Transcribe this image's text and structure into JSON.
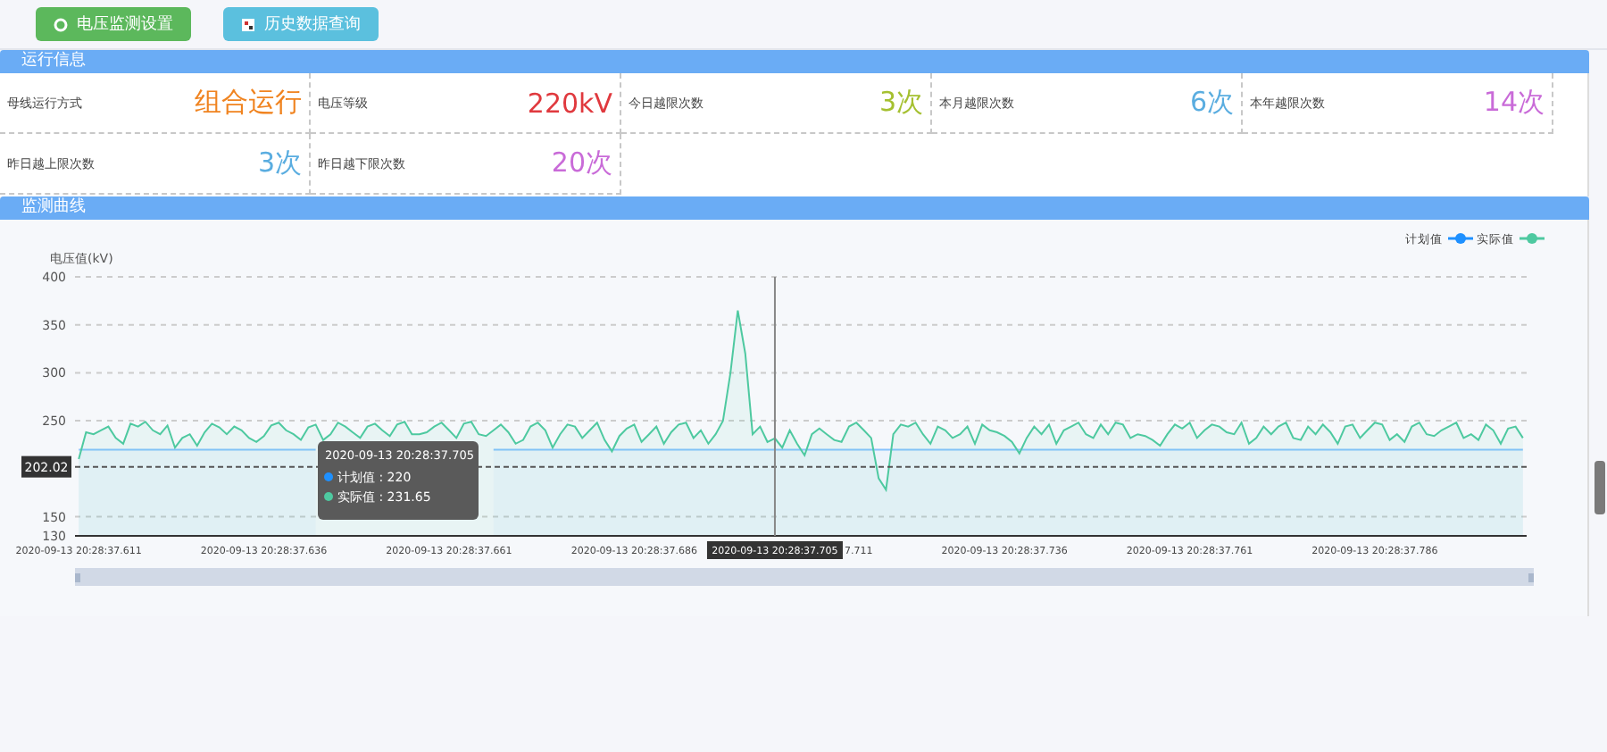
{
  "toolbar": {
    "buttons": [
      {
        "label": "电压监测设置",
        "kind": "settings",
        "color": "#5cb85c"
      },
      {
        "label": "历史数据查询",
        "kind": "query",
        "color": "#5bc0de"
      }
    ]
  },
  "run_info": {
    "title": "运行信息",
    "rows": [
      [
        {
          "label": "母线运行方式",
          "value": "组合运行",
          "color": "#f0831f"
        },
        {
          "label": "电压等级",
          "value": "220kV",
          "color": "#e0393e"
        },
        {
          "label": "今日越限次数",
          "value": "3次",
          "color": "#a5c030"
        },
        {
          "label": "本月越限次数",
          "value": "6次",
          "color": "#5aade0"
        },
        {
          "label": "本年越限次数",
          "value": "14次",
          "color": "#c96bd8"
        }
      ],
      [
        {
          "label": "昨日越上限次数",
          "value": "3次",
          "color": "#5aade0"
        },
        {
          "label": "昨日越下限次数",
          "value": "20次",
          "color": "#c96bd8"
        }
      ]
    ]
  },
  "curve": {
    "title": "监测曲线",
    "pointer": {
      "x_label": "2020-09-13 20:28:37.705",
      "partly_hidden_tick": "7.711"
    },
    "tooltip": {
      "time": "2020-09-13 20:28:37.705",
      "lines": [
        {
          "label": "计划值 : 220",
          "color": "#1e90ff"
        },
        {
          "label": "实际值 : 231.65",
          "color": "#4ec9a0"
        }
      ]
    },
    "chart_data": {
      "type": "area",
      "ylabel": "电压值(kV)",
      "ylim": [
        130,
        400
      ],
      "yticks": [
        130,
        150,
        250,
        300,
        350,
        400
      ],
      "grid": true,
      "legend": "top-right",
      "ref_lines": [
        {
          "axis": "y",
          "value": 202.02,
          "label": "202.02"
        }
      ],
      "categories": [
        "2020-09-13 20:28:37.611",
        null,
        null,
        null,
        null,
        null,
        null,
        null,
        null,
        null,
        null,
        null,
        null,
        null,
        null,
        null,
        null,
        null,
        null,
        null,
        null,
        null,
        null,
        null,
        null,
        "2020-09-13 20:28:37.636",
        null,
        null,
        null,
        null,
        null,
        null,
        null,
        null,
        null,
        null,
        null,
        null,
        null,
        null,
        null,
        null,
        null,
        null,
        null,
        null,
        null,
        null,
        null,
        null,
        "2020-09-13 20:28:37.661",
        null,
        null,
        null,
        null,
        null,
        null,
        null,
        null,
        null,
        null,
        null,
        null,
        null,
        null,
        null,
        null,
        null,
        null,
        null,
        null,
        null,
        null,
        null,
        null,
        "2020-09-13 20:28:37.686",
        null,
        null,
        null,
        null,
        null,
        null,
        null,
        null,
        null,
        null,
        null,
        null,
        null,
        null,
        null,
        null,
        null,
        null,
        null,
        null,
        null,
        null,
        null,
        null,
        null,
        null,
        null,
        null,
        null,
        null,
        null,
        null,
        null,
        null,
        null,
        null,
        null,
        null,
        null,
        null,
        null,
        null,
        null,
        null,
        null,
        null,
        null,
        null,
        null,
        "2020-09-13 20:28:37.736",
        null,
        null,
        null,
        null,
        null,
        null,
        null,
        null,
        null,
        null,
        null,
        null,
        null,
        null,
        null,
        null,
        null,
        null,
        null,
        null,
        null,
        null,
        null,
        null,
        "2020-09-13 20:28:37.761",
        null,
        null,
        null,
        null,
        null,
        null,
        null,
        null,
        null,
        null,
        null,
        null,
        null,
        null,
        null,
        null,
        null,
        null,
        null,
        null,
        null,
        null,
        null,
        null,
        "2020-09-13 20:28:37.786",
        null,
        null,
        null,
        null,
        null,
        null,
        null,
        null,
        null,
        null,
        null,
        null,
        null,
        null,
        null,
        null,
        null,
        null,
        null,
        null
      ],
      "series": [
        {
          "name": "计划值",
          "color": "#1e90ff",
          "values": [
            220,
            220,
            220,
            220,
            220,
            220,
            220,
            220,
            220,
            220,
            220,
            220,
            220,
            220,
            220,
            220,
            220,
            220,
            220,
            220,
            220,
            220,
            220,
            220,
            220,
            220,
            220,
            220,
            220,
            220,
            220,
            220,
            220,
            null,
            null,
            null,
            null,
            null,
            null,
            null,
            null,
            null,
            null,
            null,
            null,
            null,
            null,
            null,
            null,
            null,
            null,
            null,
            null,
            null,
            null,
            null,
            220,
            220,
            220,
            220,
            220,
            220,
            220,
            220,
            220,
            220,
            220,
            220,
            220,
            220,
            220,
            220,
            220,
            220,
            220,
            220,
            220,
            220,
            220,
            220,
            220,
            220,
            220,
            220,
            220,
            220,
            220,
            220,
            220,
            220,
            220,
            220,
            220,
            220,
            220,
            220,
            220,
            220,
            220,
            220,
            220,
            220,
            220,
            220,
            220,
            220,
            220,
            220,
            220,
            220,
            220,
            220,
            220,
            220,
            220,
            220,
            220,
            220,
            220,
            220,
            220,
            220,
            220,
            220,
            220,
            220,
            220,
            220,
            220,
            220,
            220,
            220,
            220,
            220,
            220,
            220,
            220,
            220,
            220,
            220,
            220,
            220,
            220,
            220,
            220,
            220,
            220,
            220,
            220,
            220,
            220,
            220,
            220,
            220,
            220,
            220,
            220,
            220,
            220,
            220,
            220,
            220,
            220,
            220,
            220,
            220,
            220,
            220,
            220,
            220,
            220,
            220,
            220,
            220,
            220,
            220,
            220,
            220,
            220,
            220,
            220,
            220,
            220,
            220,
            220,
            220,
            220,
            220,
            220,
            220,
            220,
            220,
            220,
            220,
            220,
            220
          ]
        },
        {
          "name": "实际值",
          "color": "#4ec9a0",
          "values": [
            210,
            238,
            236,
            240,
            244,
            232,
            226,
            247,
            244,
            249,
            240,
            236,
            245,
            222,
            232,
            236,
            224,
            238,
            247,
            243,
            236,
            244,
            240,
            232,
            228,
            234,
            245,
            248,
            240,
            236,
            230,
            243,
            246,
            230,
            236,
            248,
            244,
            238,
            232,
            244,
            247,
            240,
            234,
            246,
            249,
            236,
            236,
            238,
            244,
            248,
            240,
            232,
            247,
            249,
            236,
            234,
            240,
            246,
            238,
            226,
            230,
            244,
            248,
            240,
            222,
            236,
            246,
            244,
            232,
            240,
            248,
            230,
            218,
            234,
            242,
            246,
            228,
            236,
            244,
            226,
            238,
            246,
            248,
            232,
            240,
            226,
            236,
            250,
            300,
            365,
            320,
            236,
            244,
            228,
            231.65,
            222,
            240,
            226,
            214,
            236,
            242,
            236,
            230,
            228,
            244,
            248,
            240,
            232,
            190,
            178,
            236,
            246,
            244,
            248,
            236,
            226,
            244,
            240,
            232,
            236,
            244,
            226,
            246,
            240,
            238,
            234,
            228,
            216,
            232,
            244,
            236,
            246,
            226,
            240,
            244,
            248,
            236,
            232,
            246,
            236,
            248,
            246,
            232,
            236,
            234,
            230,
            224,
            236,
            246,
            242,
            248,
            232,
            240,
            246,
            244,
            238,
            236,
            248,
            226,
            232,
            244,
            236,
            244,
            248,
            232,
            230,
            244,
            236,
            246,
            238,
            226,
            244,
            246,
            232,
            240,
            248,
            246,
            230,
            236,
            228,
            244,
            248,
            236,
            234,
            240,
            244,
            248,
            232,
            236,
            230,
            246,
            240,
            226,
            242,
            244,
            232
          ]
        }
      ]
    }
  }
}
